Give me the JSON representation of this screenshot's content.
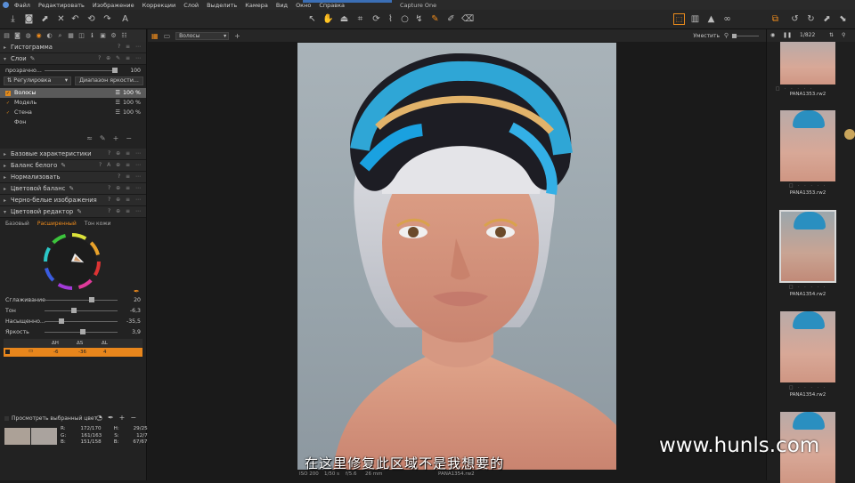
{
  "menu": {
    "items": [
      "Файл",
      "Редактировать",
      "Изображение",
      "Коррекции",
      "Слой",
      "Выделить",
      "Камера",
      "Вид",
      "Окно",
      "Справка"
    ],
    "app_title": "Capture One"
  },
  "panels": {
    "histogram": "Гистограмма",
    "layers": "Слои",
    "opacity_label": "прозрачно...",
    "opacity_value": "100",
    "adjust_dropdown": "Регулировка",
    "luma_range_button": "Диапазон яркости...",
    "layers_list": [
      {
        "name": "Волосы",
        "pct": "100 %",
        "checked": true,
        "selected": true
      },
      {
        "name": "Модель",
        "pct": "100 %",
        "checked": true,
        "selected": false
      },
      {
        "name": "Стена",
        "pct": "100 %",
        "checked": true,
        "selected": false
      },
      {
        "name": "Фон",
        "pct": "",
        "checked": false,
        "selected": false
      }
    ],
    "basic_chars": "Базовые характеристики",
    "white_balance": "Баланс белого",
    "normalize": "Нормализовать",
    "color_balance": "Цветовой баланс",
    "bw": "Черно-белые изображения",
    "color_editor": "Цветовой редактор",
    "tabs": [
      "Базовый",
      "Расширенный",
      "Тон кожи"
    ],
    "sliders": [
      {
        "label": "Сглаживание",
        "value": "20",
        "pos": 0.75
      },
      {
        "label": "Тон",
        "value": "-6,3",
        "pos": 0.35
      },
      {
        "label": "Насыщенно...",
        "value": "-35,5",
        "pos": 0.25
      },
      {
        "label": "Яркость",
        "value": "3,9",
        "pos": 0.55
      }
    ],
    "table_headers": [
      "ΔH",
      "ΔS",
      "ΔL"
    ],
    "table_row": [
      "-6",
      "-36",
      "4"
    ],
    "preview_selected": "Просмотреть выбранный цвет...",
    "readout": {
      "R": "172/170",
      "G": "161/163",
      "B": "151/158",
      "H": "29/25",
      "S": "12/7",
      "Bv": "67/67"
    }
  },
  "viewer": {
    "variant": "Волосы",
    "fit_label": "Уместить",
    "status": {
      "iso": "ISO 200",
      "shutter": "1/50 s",
      "aperture": "f/5.6",
      "focal": "26 mm",
      "filename": "PANA1354.rw2"
    }
  },
  "filmstrip": {
    "counter": "1/822",
    "items": [
      {
        "name": "PANA1353.rw2"
      },
      {
        "name": "PANA1353.rw2"
      },
      {
        "name": "PANA1354.rw2"
      },
      {
        "name": "PANA1354.rw2"
      },
      {
        "name": ""
      }
    ]
  },
  "overlay": {
    "subtitle": "在这里修复此区域不是我想要的",
    "watermark": "www.hunls.com"
  }
}
